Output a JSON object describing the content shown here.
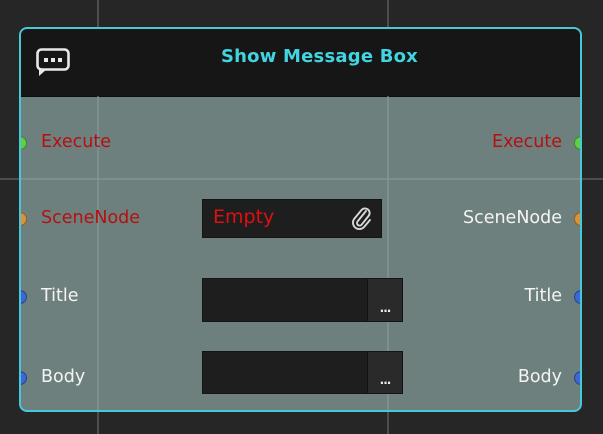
{
  "node": {
    "title": "Show Message Box",
    "header_icon": "message-bubble-icon"
  },
  "rows": {
    "execute": {
      "left_label": "Execute",
      "right_label": "Execute",
      "pin_color": "#5fcf48",
      "label_color": "#b41010"
    },
    "scene_node": {
      "left_label": "SceneNode",
      "right_label": "SceneNode",
      "pin_color": "#d9943a",
      "field_value": "Empty",
      "field_icon": "paperclip-icon"
    },
    "title": {
      "left_label": "Title",
      "right_label": "Title",
      "pin_color": "#3d66d6",
      "field_value": "",
      "button_label": "..."
    },
    "body": {
      "left_label": "Body",
      "right_label": "Body",
      "pin_color": "#3d66d6",
      "field_value": "",
      "button_label": "..."
    }
  },
  "colors": {
    "canvas": "#262626",
    "node_body": "#6e807e",
    "node_border": "#45c8d8",
    "header_bg": "#161616",
    "title_text": "#42d4e0",
    "error_text": "#e01010"
  }
}
